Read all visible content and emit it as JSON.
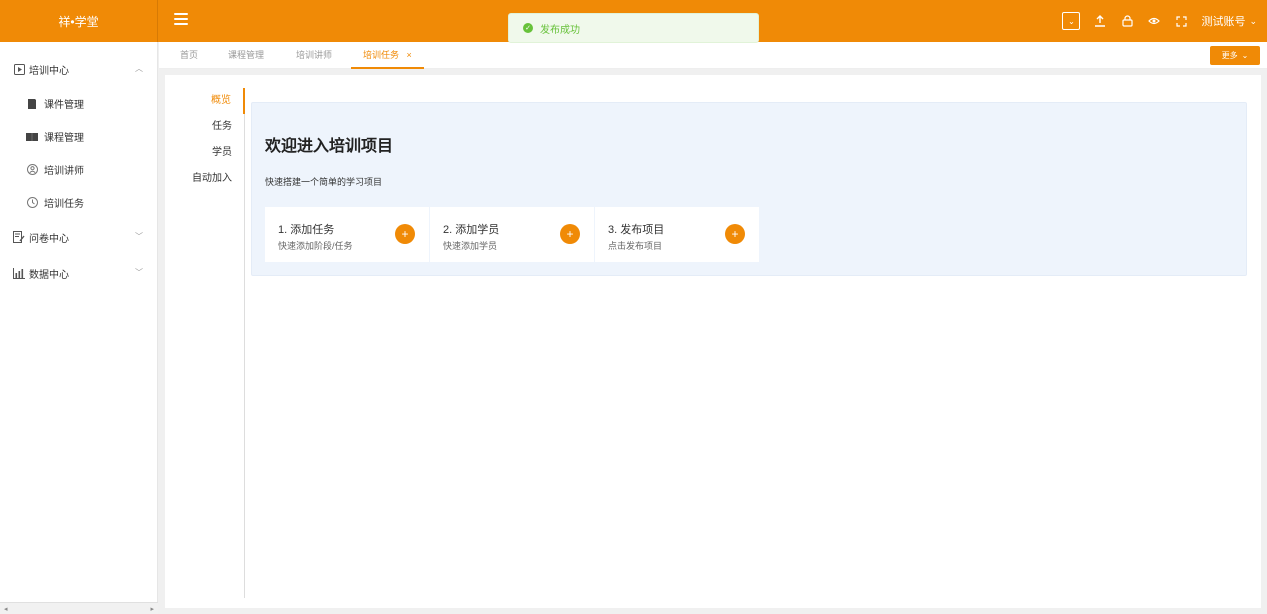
{
  "app": {
    "logo": "祥•学堂"
  },
  "toast": {
    "message": "发布成功"
  },
  "header": {
    "account": "测试账号"
  },
  "sidebar": {
    "groups": [
      {
        "label": "培训中心",
        "items": [
          "课件管理",
          "课程管理",
          "培训讲师",
          "培训任务"
        ]
      },
      {
        "label": "问卷中心"
      },
      {
        "label": "数据中心"
      }
    ]
  },
  "tabs": [
    {
      "label": "首页"
    },
    {
      "label": "课程管理"
    },
    {
      "label": "培训讲师"
    },
    {
      "label": "培训任务"
    }
  ],
  "more_button": "更多",
  "subnav": [
    "概览",
    "任务",
    "学员",
    "自动加入"
  ],
  "main": {
    "title": "欢迎进入培训项目",
    "subtitle": "快速搭建一个简单的学习项目",
    "steps": [
      {
        "title": "1. 添加任务",
        "desc": "快速添加阶段/任务"
      },
      {
        "title": "2. 添加学员",
        "desc": "快速添加学员"
      },
      {
        "title": "3. 发布项目",
        "desc": "点击发布项目"
      }
    ]
  },
  "colors": {
    "accent": "#f08a06",
    "panel_bg": "#eef4fc",
    "success": "#67c23a"
  }
}
